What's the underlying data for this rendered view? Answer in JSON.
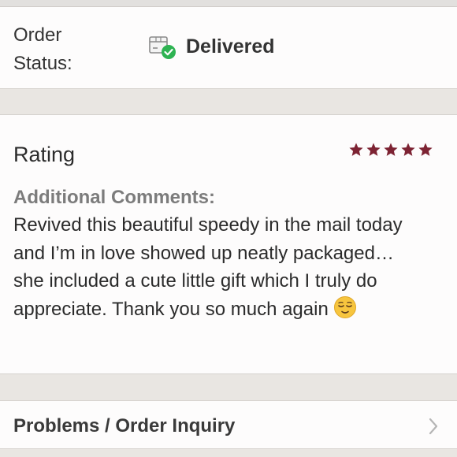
{
  "order_status": {
    "label_line1": "Order",
    "label_line2": "Status:",
    "value": "Delivered",
    "icon": "delivered-box-check-icon"
  },
  "rating": {
    "title": "Rating",
    "stars": 5,
    "max_stars": 5,
    "star_color": "#7d2333",
    "comments_heading": "Additional Comments:",
    "comments_text": "Revived this beautiful speedy in the mail today and I’m in love showed up neatly packaged…she included a cute little gift which I truly do appreciate. Thank you so much again",
    "comments_emoji": "relieved-face-emoji"
  },
  "inquiry": {
    "label": "Problems / Order Inquiry",
    "icon": "chevron-right-icon"
  },
  "colors": {
    "background": "#e9e6e2",
    "card": "#fdfcfc",
    "check_green": "#2eb352",
    "muted_text": "#7c7c7c"
  }
}
